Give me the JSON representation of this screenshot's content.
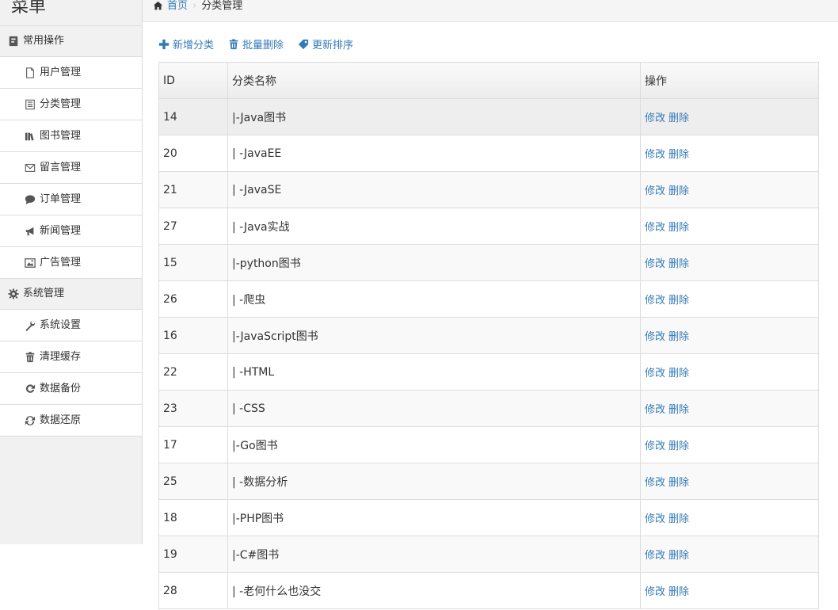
{
  "sidebar": {
    "title": "菜单",
    "groups": [
      {
        "label": "常用操作",
        "icon": "book-icon",
        "items": [
          {
            "label": "用户管理",
            "icon": "file-icon"
          },
          {
            "label": "分类管理",
            "icon": "list-icon"
          },
          {
            "label": "图书管理",
            "icon": "books-icon"
          },
          {
            "label": "留言管理",
            "icon": "envelope-icon"
          },
          {
            "label": "订单管理",
            "icon": "comment-icon"
          },
          {
            "label": "新闻管理",
            "icon": "bullhorn-icon"
          },
          {
            "label": "广告管理",
            "icon": "picture-icon"
          }
        ]
      },
      {
        "label": "系统管理",
        "icon": "gear-icon",
        "items": [
          {
            "label": "系统设置",
            "icon": "wrench-icon"
          },
          {
            "label": "清理缓存",
            "icon": "trash-icon"
          },
          {
            "label": "数据备份",
            "icon": "refresh-icon"
          },
          {
            "label": "数据还原",
            "icon": "sync-icon"
          }
        ]
      }
    ]
  },
  "breadcrumb": {
    "home": "首页",
    "current": "分类管理"
  },
  "toolbar": {
    "add": "新增分类",
    "batch_delete": "批量删除",
    "update_sort": "更新排序"
  },
  "table": {
    "headers": {
      "id": "ID",
      "name": "分类名称",
      "ops": "操作"
    },
    "edit_label": "修改",
    "delete_label": "删除",
    "rows": [
      {
        "id": "14",
        "name": "|-Java图书",
        "child": false
      },
      {
        "id": "20",
        "name": "| -JavaEE",
        "child": true
      },
      {
        "id": "21",
        "name": "| -JavaSE",
        "child": true
      },
      {
        "id": "27",
        "name": "| -Java实战",
        "child": true
      },
      {
        "id": "15",
        "name": "|-python图书",
        "child": false
      },
      {
        "id": "26",
        "name": "| -爬虫",
        "child": true
      },
      {
        "id": "16",
        "name": "|-JavaScript图书",
        "child": false
      },
      {
        "id": "22",
        "name": "| -HTML",
        "child": true
      },
      {
        "id": "23",
        "name": "| -CSS",
        "child": true
      },
      {
        "id": "17",
        "name": "|-Go图书",
        "child": false
      },
      {
        "id": "25",
        "name": "| -数据分析",
        "child": true
      },
      {
        "id": "18",
        "name": "|-PHP图书",
        "child": false
      },
      {
        "id": "19",
        "name": "|-C#图书",
        "child": false
      },
      {
        "id": "28",
        "name": "| -老何什么也没交",
        "child": true
      }
    ]
  },
  "colors": {
    "link": "#337ab7",
    "sidebar_bg": "#f1f1f1"
  }
}
